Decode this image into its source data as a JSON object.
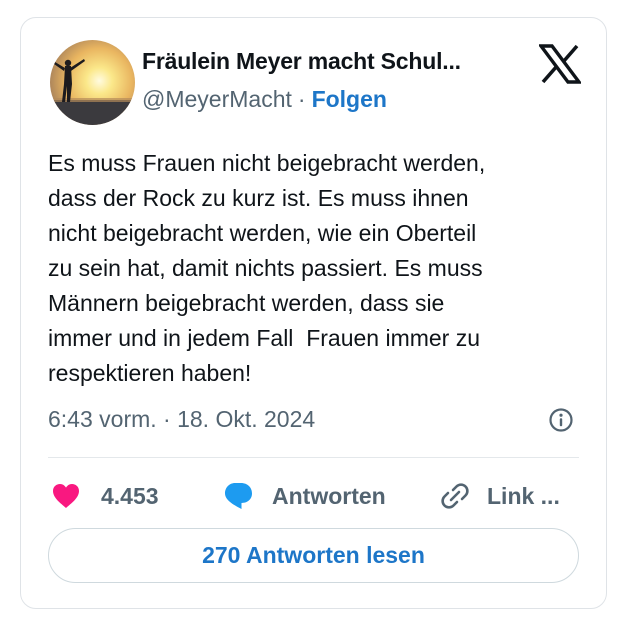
{
  "author": {
    "display_name": "Fräulein Meyer macht Schul...",
    "handle": "@MeyerMacht",
    "separator": "·",
    "follow_label": "Folgen"
  },
  "platform_icon": "x-logo-icon",
  "tweet": {
    "text": "Es muss Frauen nicht beigebracht werden,\ndass der Rock zu kurz ist. Es muss ihnen\nnicht beigebracht werden, wie ein Oberteil\nzu sein hat, damit nichts passiert. Es muss\nMännern beigebracht werden, dass sie\nimmer und in jedem Fall  Frauen immer zu\nrespektieren haben!",
    "timestamp": "6:43 vorm. · 18. Okt. 2024"
  },
  "actions": {
    "like_count": "4.453",
    "reply_label": "Antworten",
    "link_label": "Link ..."
  },
  "read_replies_label": "270 Antworten lesen",
  "colors": {
    "like": "#f91880",
    "reply": "#1d9bf0",
    "link_accent": "#1d76c8",
    "muted": "#536471",
    "text": "#0f1419"
  }
}
